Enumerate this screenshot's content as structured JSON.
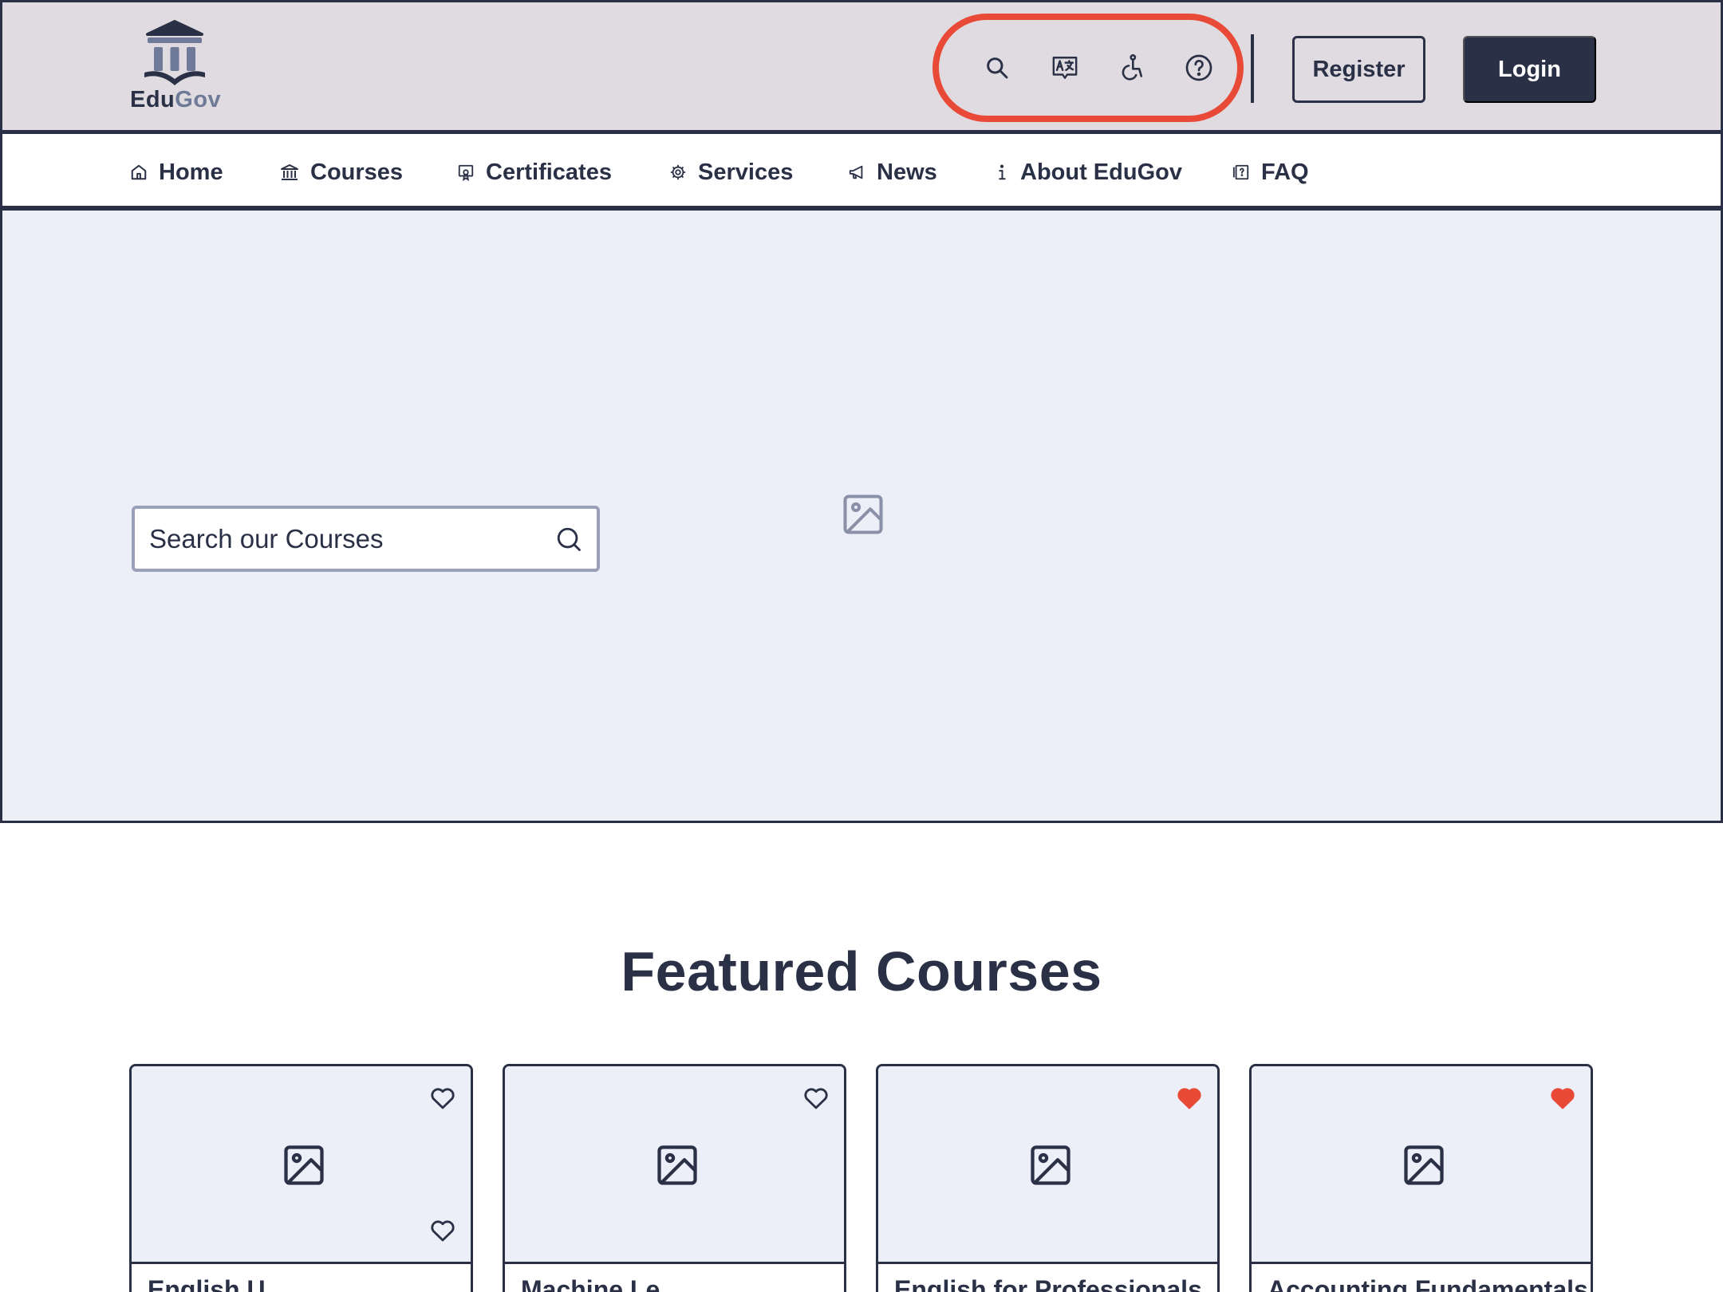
{
  "header": {
    "logo": {
      "text_primary": "Edu",
      "text_secondary": "Gov",
      "icon": "institution-book-icon"
    },
    "utility_icons": [
      {
        "name": "search-icon",
        "label": "Search"
      },
      {
        "name": "translate-icon",
        "label": "Language"
      },
      {
        "name": "accessibility-icon",
        "label": "Accessibility"
      },
      {
        "name": "help-icon",
        "label": "Help"
      }
    ],
    "register_label": "Register",
    "login_label": "Login",
    "highlight_color": "#e84a37"
  },
  "nav": {
    "items": [
      {
        "label": "Home",
        "icon": "home-icon"
      },
      {
        "label": "Courses",
        "icon": "institution-icon"
      },
      {
        "label": "Certificates",
        "icon": "certificate-icon"
      },
      {
        "label": "Services",
        "icon": "gear-icon"
      },
      {
        "label": "News",
        "icon": "megaphone-icon"
      },
      {
        "label": "About EduGov",
        "icon": "info-icon"
      },
      {
        "label": "FAQ",
        "icon": "faq-book-icon"
      }
    ]
  },
  "hero": {
    "search": {
      "placeholder": "Search our Courses",
      "icon": "search-icon"
    },
    "image_icon": "image-placeholder-icon"
  },
  "featured": {
    "title": "Featured Courses",
    "cards": [
      {
        "title": "English U...",
        "favorited": false
      },
      {
        "title": "Machine Le...",
        "favorited": false
      },
      {
        "title": "English for Professionals",
        "favorited": true
      },
      {
        "title": "Accounting Fundamentals",
        "favorited": true
      }
    ]
  },
  "colors": {
    "primary": "#2a3146",
    "header_bg": "#dfdbe0",
    "hero_bg": "#edeff8",
    "heart_active": "#e84a37"
  }
}
